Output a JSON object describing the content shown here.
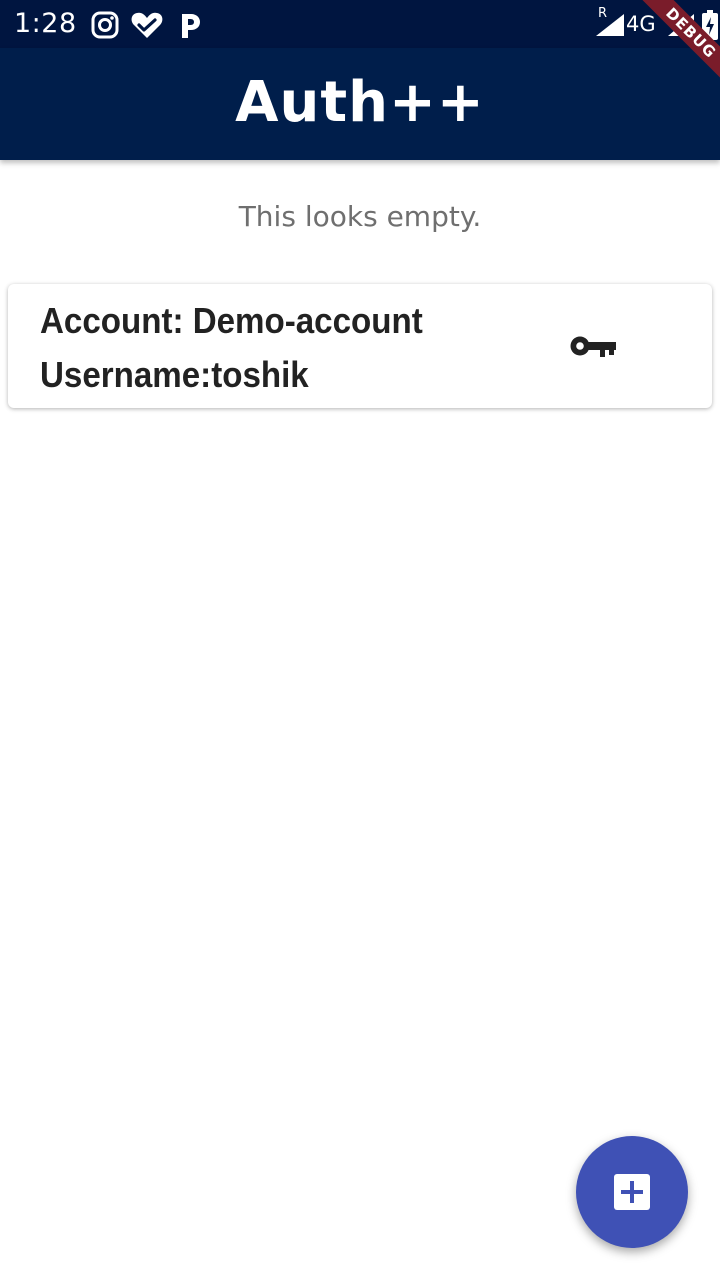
{
  "status_bar": {
    "time": "1:28",
    "roaming_indicator": "R",
    "network_type": "4G",
    "icons": [
      "instagram-icon",
      "heart-check-icon",
      "p-icon",
      "signal-icon",
      "battery-icon"
    ]
  },
  "app_bar": {
    "title": "Auth++"
  },
  "debug_banner": {
    "label": "DEBUG"
  },
  "content": {
    "empty_message": "This looks empty."
  },
  "accounts": [
    {
      "account_line": "Account: Demo-account",
      "username_line": "Username:toshik",
      "icon": "key-icon"
    }
  ],
  "fab": {
    "icon": "add-box-icon"
  },
  "colors": {
    "status_bar_bg": "#001540",
    "app_bar_bg": "#001e4b",
    "fab_bg": "#3f51b5",
    "debug_banner": "#7a1c2a",
    "empty_text": "#6f6f6f"
  }
}
